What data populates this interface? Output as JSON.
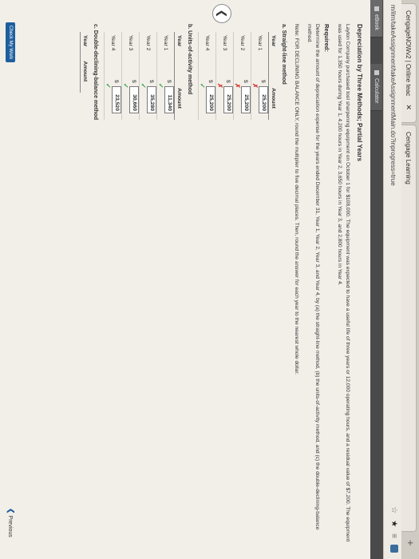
{
  "browser": {
    "tabs": [
      {
        "label": "CengageNOWv2 | Online teac"
      },
      {
        "label": "Cengage Learning"
      }
    ],
    "url": "m/ilrn/takeAssignment/takeAssignmentMain.do?inprogress=true"
  },
  "toolbar": {
    "ebook_label": "eBook",
    "calculator_label": "Calculator"
  },
  "problem": {
    "title": "Depreciation by Three Methods; Partial Years",
    "body": "Layton Company purchased tool sharpening equipment on October 1 for $108,000. The equipment was expected to have a useful life of three years or 12,000 operating hours, and a residual value of $7,200. The equipment was used for 1,350 hours during Year 1, 4,200 hours in Year 2, 3,650 hours in Year 3, and 2,800 hours in Year 4.",
    "required_label": "Required:",
    "instructions": "Determine the amount of depreciation expense for the years ended December 31, Year 1, Year 2, Year 3, and Year 4, by (a) the straight-line method, (b) the units-of-activity method, and (c) the double-declining-balance method.",
    "note": "Note: FOR DECLINING BALANCE ONLY, round the multiplier to five decimal places. Then, round the answer for each year to the nearest whole dollar."
  },
  "sections": {
    "a": {
      "label": "a. Straight-line method",
      "year_header": "Year",
      "amount_header": "Amount",
      "rows": [
        {
          "year": "Year 1",
          "dollar": "$",
          "value": "25,200",
          "status": "wrong"
        },
        {
          "year": "Year 2",
          "dollar": "$",
          "value": "25,200",
          "status": "wrong"
        },
        {
          "year": "Year 3",
          "dollar": "$",
          "value": "25,200",
          "status": "wrong"
        },
        {
          "year": "Year 4",
          "dollar": "$",
          "value": "25,200",
          "status": "correct"
        }
      ]
    },
    "b": {
      "label": "b. Units-of-activity method",
      "year_header": "Year",
      "amount_header": "Amount",
      "rows": [
        {
          "year": "Year 1",
          "dollar": "$",
          "value": "11,340",
          "status": "correct"
        },
        {
          "year": "Year 2",
          "dollar": "$",
          "value": "35,280",
          "status": "correct"
        },
        {
          "year": "Year 3",
          "dollar": "$",
          "value": "30,660",
          "status": "correct"
        },
        {
          "year": "Year 4",
          "dollar": "$",
          "value": "23,520",
          "status": "correct"
        }
      ]
    },
    "c": {
      "label": "c. Double-declining-balance method",
      "year_header": "Year",
      "amount_header": "Amount"
    }
  },
  "marks": {
    "wrong": "✗",
    "correct": "✓"
  },
  "footer": {
    "check_label": "Check My Work",
    "previous_label": "Previous"
  },
  "colors": {
    "wrong": "#d0352b",
    "correct": "#2e9e3f",
    "accent": "#1f5e9e"
  }
}
